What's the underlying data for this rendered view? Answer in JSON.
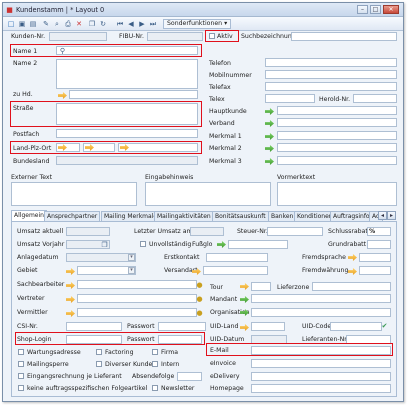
{
  "window": {
    "title": "Kundenstamm | * Layout 0",
    "min": "–",
    "max": "□",
    "close": "✕"
  },
  "toolbar": {
    "sonder": "Sonderfunktionen",
    "dd": "▾"
  },
  "header": {
    "kunden_nr": "Kunden-Nr.",
    "fibu_nr": "FIBU-Nr.",
    "aktiv": "Aktiv",
    "suchbezeichnung": "Suchbezeichnung"
  },
  "address": {
    "name1": "Name 1",
    "name2": "Name 2",
    "zuhd": "zu Hd.",
    "strasse": "Straße",
    "postfach": "Postfach",
    "lpo": "Land-Plz-Ort",
    "bundesland": "Bundesland"
  },
  "contact": {
    "telefon": "Telefon",
    "mobil": "Mobilnummer",
    "telefax": "Telefax",
    "telex": "Telex",
    "herold": "Herold-Nr.",
    "hauptkunde": "Hauptkunde",
    "verband": "Verband",
    "merkmal1": "Merkmal 1",
    "merkmal2": "Merkmal 2",
    "merkmal3": "Merkmal 3"
  },
  "notes": {
    "externer": "Externer Text",
    "eingabe": "Eingabehinweis",
    "vormerk": "Vormerktext"
  },
  "tabs": [
    "Allgemein",
    "Ansprechpartner",
    "Mailing Merkmale",
    "Mailingaktivitäten",
    "Bonitätsauskunft",
    "Banken",
    "Konditionen",
    "Auftragsinfo",
    "Ad"
  ],
  "tab_nav": {
    "left": "◂",
    "right": "▸"
  },
  "allgemein": {
    "umsatz_aktuell": "Umsatz aktuell",
    "letzter_umsatz": "Letzter Umsatz am",
    "steuer_nr": "Steuer-Nr.",
    "schlussrabatt": "Schlussrabatt",
    "pct": "%",
    "umsatz_vorjahr": "Umsatz Vorjahr",
    "unvollstaendig": "Unvollständig",
    "fussglo": "Fußglo",
    "grundrabatt": "Grundrabatt",
    "anlagedatum": "Anlagedatum",
    "erstkontakt": "Erstkontakt",
    "fremdsprache": "Fremdsprache",
    "gebiet": "Gebiet",
    "versandart": "Versandart",
    "fremdwaehrung": "Fremdwährung",
    "sachbearbeiter": "Sachbearbeiter",
    "tour": "Tour",
    "lieferzone": "Lieferzone",
    "vertreter": "Vertreter",
    "mandant": "Mandant",
    "vermittler": "Vermittler",
    "organisation": "Organisation",
    "csi_nr": "CSI-Nr.",
    "passwort1": "Passwort",
    "uid_land": "UID-Land",
    "uid_code": "UID-Code",
    "shop_login": "Shop-Login",
    "passwort2": "Passwort",
    "uid_datum": "UID-Datum",
    "lieferanten_nr": "Lieferanten-Nr.",
    "wartungsadresse": "Wartungsadresse",
    "factoring": "Factoring",
    "firma": "Firma",
    "email": "E-Mail",
    "mailingsperre": "Mailingsperre",
    "diverser_kunde": "Diverser Kunde",
    "intern": "Intern",
    "einvoice": "eInvoice",
    "eingangsrechnung": "Eingangsrechnung je Lieferant",
    "absendefolge": "Absendefolge",
    "edelivery": "eDelivery",
    "keine_folgeartikel": "keine auftragsspezifischen Folgeartikel",
    "newsletter": "Newsletter",
    "homepage": "Homepage"
  }
}
